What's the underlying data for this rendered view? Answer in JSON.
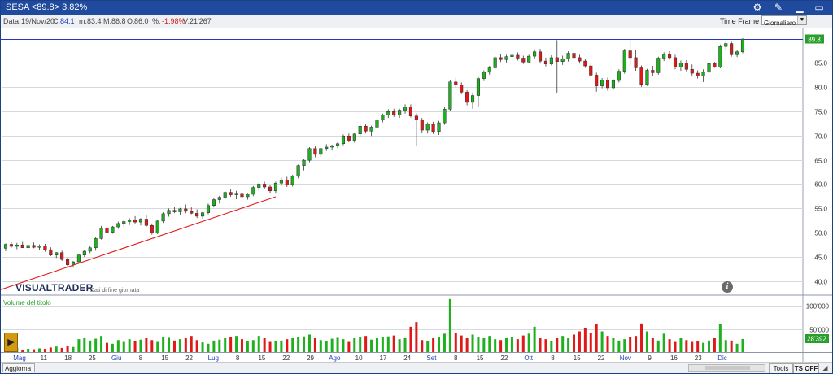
{
  "titlebar": {
    "title": "SESA <89.8> 3.82%"
  },
  "infobar": {
    "date_label": "Data:",
    "date": "19/Nov/20",
    "close_label": "C:",
    "close": "84.1",
    "min_label": "m:",
    "min": "83.4",
    "max_label": "M:",
    "max": "86.8",
    "open_label": "O:",
    "open": "86.0",
    "pct_label": "%:",
    "pct": "-1.98%",
    "vol_label": "V:",
    "vol": "21'267",
    "timeframe_label": "Time Frame",
    "timeframe_value": "Giornaliero"
  },
  "watermark": {
    "brand": "VISUALTRADER",
    "sub": "Dati di fine giornata"
  },
  "volume_title": "Volume del titolo",
  "bottombar": {
    "refresh": "Aggiorna",
    "tools": "Tools",
    "ts_off": "TS OFF"
  },
  "colors": {
    "up": "#1fb01f",
    "down": "#e01818",
    "trendline": "#e41a1a",
    "title_bg": "#1f4a9e",
    "last_price_bg": "#2a9e2a"
  },
  "chart_data": {
    "type": "candlestick",
    "price_axis": {
      "ylim": [
        37.5,
        91
      ],
      "ticks": [
        40.0,
        45.0,
        50.0,
        55.0,
        60.0,
        65.0,
        70.0,
        75.0,
        80.0,
        85.0
      ],
      "last_price": 89.8,
      "last_price_label": "89.8"
    },
    "volume_axis": {
      "ylim": [
        0,
        120000
      ],
      "ticks": [
        50000,
        100000
      ],
      "tick_labels": [
        "50'000",
        "100'000"
      ],
      "last_volume_label": "28'392"
    },
    "x_labels": [
      "Mag",
      "11",
      "18",
      "25",
      "Giu",
      "8",
      "15",
      "22",
      "Lug",
      "8",
      "15",
      "22",
      "29",
      "Ago",
      "10",
      "17",
      "24",
      "Set",
      "8",
      "15",
      "22",
      "Ott",
      "8",
      "15",
      "22",
      "Nov",
      "9",
      "16",
      "23",
      "Dic"
    ],
    "x_label_colors": [
      "blue",
      "dark",
      "dark",
      "dark",
      "blue",
      "dark",
      "dark",
      "dark",
      "blue",
      "dark",
      "dark",
      "dark",
      "dark",
      "blue",
      "dark",
      "dark",
      "dark",
      "blue",
      "dark",
      "dark",
      "dark",
      "blue",
      "dark",
      "dark",
      "dark",
      "blue",
      "dark",
      "dark",
      "dark",
      "blue"
    ],
    "ohlc": [
      [
        46.8,
        47.8,
        46.2,
        47.6
      ],
      [
        47.6,
        48.0,
        46.9,
        47.2
      ],
      [
        47.2,
        47.9,
        46.6,
        47.5
      ],
      [
        47.5,
        48.1,
        47.0,
        46.9
      ],
      [
        46.9,
        47.6,
        46.3,
        47.4
      ],
      [
        47.4,
        48.0,
        46.8,
        47.0
      ],
      [
        47.0,
        47.6,
        46.4,
        47.3
      ],
      [
        47.3,
        47.7,
        46.1,
        46.5
      ],
      [
        46.5,
        47.0,
        45.2,
        45.4
      ],
      [
        45.4,
        46.0,
        44.8,
        45.9
      ],
      [
        45.9,
        46.3,
        44.2,
        44.5
      ],
      [
        44.5,
        44.9,
        43.0,
        43.4
      ],
      [
        43.4,
        44.2,
        42.8,
        44.0
      ],
      [
        44.0,
        45.6,
        43.7,
        45.4
      ],
      [
        45.4,
        46.5,
        45.0,
        46.2
      ],
      [
        46.2,
        47.2,
        45.8,
        46.9
      ],
      [
        46.9,
        49.2,
        46.3,
        48.8
      ],
      [
        48.8,
        51.4,
        48.6,
        51.0
      ],
      [
        51.0,
        51.8,
        49.5,
        50.1
      ],
      [
        50.1,
        51.4,
        49.8,
        51.2
      ],
      [
        51.2,
        52.3,
        50.8,
        51.9
      ],
      [
        51.9,
        52.6,
        51.3,
        52.3
      ],
      [
        52.3,
        53.0,
        51.6,
        52.6
      ],
      [
        52.6,
        53.4,
        51.9,
        52.2
      ],
      [
        52.2,
        53.0,
        51.5,
        52.8
      ],
      [
        52.8,
        53.6,
        51.2,
        51.5
      ],
      [
        51.5,
        51.9,
        49.6,
        50.0
      ],
      [
        50.0,
        52.7,
        49.7,
        52.4
      ],
      [
        52.4,
        54.2,
        52.0,
        53.9
      ],
      [
        53.9,
        55.0,
        53.3,
        54.6
      ],
      [
        54.6,
        55.3,
        54.0,
        54.3
      ],
      [
        54.3,
        55.1,
        53.6,
        54.9
      ],
      [
        54.9,
        55.8,
        54.0,
        54.4
      ],
      [
        54.4,
        55.2,
        53.8,
        54.0
      ],
      [
        54.0,
        54.8,
        53.0,
        53.4
      ],
      [
        53.4,
        54.3,
        52.9,
        54.1
      ],
      [
        54.1,
        56.0,
        53.8,
        55.6
      ],
      [
        55.6,
        57.1,
        55.2,
        56.8
      ],
      [
        56.8,
        57.6,
        56.0,
        57.3
      ],
      [
        57.3,
        58.6,
        56.8,
        58.3
      ],
      [
        58.3,
        59.0,
        57.4,
        57.8
      ],
      [
        57.8,
        58.6,
        56.9,
        58.1
      ],
      [
        58.1,
        58.8,
        57.0,
        57.4
      ],
      [
        57.4,
        58.2,
        56.8,
        57.9
      ],
      [
        57.9,
        59.6,
        57.5,
        59.3
      ],
      [
        59.3,
        60.3,
        58.6,
        60.0
      ],
      [
        60.0,
        60.5,
        59.0,
        59.4
      ],
      [
        59.4,
        59.8,
        58.2,
        58.6
      ],
      [
        58.6,
        60.5,
        58.2,
        60.2
      ],
      [
        60.2,
        61.3,
        59.6,
        60.8
      ],
      [
        60.8,
        61.5,
        59.4,
        59.9
      ],
      [
        59.9,
        61.9,
        59.5,
        61.6
      ],
      [
        61.6,
        64.0,
        61.2,
        63.8
      ],
      [
        63.8,
        65.2,
        62.8,
        64.9
      ],
      [
        64.9,
        67.6,
        64.5,
        67.3
      ],
      [
        67.3,
        67.9,
        65.5,
        66.1
      ],
      [
        66.1,
        67.5,
        65.6,
        67.3
      ],
      [
        67.3,
        68.2,
        66.8,
        67.6
      ],
      [
        67.6,
        68.1,
        66.9,
        67.9
      ],
      [
        67.9,
        68.6,
        67.4,
        68.3
      ],
      [
        68.3,
        70.2,
        68.0,
        69.9
      ],
      [
        69.9,
        70.4,
        68.6,
        69.0
      ],
      [
        69.0,
        70.6,
        68.5,
        70.3
      ],
      [
        70.3,
        72.2,
        69.8,
        71.9
      ],
      [
        71.9,
        72.4,
        70.4,
        70.9
      ],
      [
        70.9,
        72.0,
        69.9,
        71.7
      ],
      [
        71.7,
        73.5,
        71.3,
        73.2
      ],
      [
        73.2,
        74.5,
        72.7,
        74.2
      ],
      [
        74.2,
        75.4,
        73.6,
        74.9
      ],
      [
        74.9,
        75.5,
        73.8,
        74.2
      ],
      [
        74.2,
        75.5,
        73.6,
        75.2
      ],
      [
        75.2,
        76.4,
        74.5,
        75.9
      ],
      [
        75.9,
        76.4,
        73.7,
        74.0
      ],
      [
        74.0,
        74.6,
        67.9,
        73.2
      ],
      [
        73.2,
        73.6,
        70.6,
        71.1
      ],
      [
        71.1,
        72.7,
        70.4,
        72.3
      ],
      [
        72.3,
        72.8,
        70.3,
        70.8
      ],
      [
        70.8,
        73.0,
        70.1,
        72.6
      ],
      [
        72.6,
        75.8,
        72.2,
        75.4
      ],
      [
        75.4,
        81.4,
        75.1,
        81.0
      ],
      [
        81.0,
        81.9,
        79.9,
        80.4
      ],
      [
        80.4,
        80.9,
        78.5,
        78.9
      ],
      [
        78.9,
        79.3,
        76.2,
        76.8
      ],
      [
        76.8,
        78.6,
        75.5,
        78.2
      ],
      [
        78.2,
        82.0,
        75.8,
        81.7
      ],
      [
        81.7,
        83.4,
        81.2,
        83.0
      ],
      [
        83.0,
        84.3,
        82.5,
        83.9
      ],
      [
        83.9,
        86.3,
        83.6,
        86.0
      ],
      [
        86.0,
        86.7,
        85.1,
        85.6
      ],
      [
        85.6,
        86.6,
        85.0,
        86.2
      ],
      [
        86.2,
        86.9,
        85.6,
        86.5
      ],
      [
        86.5,
        87.1,
        85.4,
        85.9
      ],
      [
        85.9,
        86.4,
        84.7,
        85.1
      ],
      [
        85.1,
        86.6,
        84.8,
        86.3
      ],
      [
        86.3,
        87.7,
        85.8,
        87.2
      ],
      [
        87.2,
        87.8,
        84.8,
        85.3
      ],
      [
        85.3,
        86.0,
        84.2,
        84.7
      ],
      [
        84.7,
        86.5,
        84.4,
        86.0
      ],
      [
        86.0,
        89.6,
        78.8,
        85.2
      ],
      [
        85.2,
        86.4,
        84.5,
        85.7
      ],
      [
        85.7,
        87.3,
        85.2,
        86.9
      ],
      [
        86.9,
        87.3,
        85.6,
        86.0
      ],
      [
        86.0,
        86.6,
        84.8,
        85.3
      ],
      [
        85.3,
        85.8,
        83.9,
        84.3
      ],
      [
        84.3,
        84.8,
        81.9,
        82.4
      ],
      [
        82.4,
        82.9,
        79.0,
        80.2
      ],
      [
        80.2,
        81.8,
        79.7,
        81.4
      ],
      [
        81.4,
        81.9,
        79.2,
        79.8
      ],
      [
        79.8,
        81.6,
        79.4,
        81.3
      ],
      [
        81.3,
        83.6,
        80.9,
        83.2
      ],
      [
        83.2,
        87.8,
        82.7,
        87.4
      ],
      [
        87.4,
        89.9,
        84.3,
        86.0
      ],
      [
        86.0,
        87.5,
        83.3,
        83.9
      ],
      [
        83.9,
        84.4,
        80.0,
        80.5
      ],
      [
        80.5,
        83.7,
        80.2,
        83.4
      ],
      [
        83.4,
        84.3,
        82.3,
        82.9
      ],
      [
        82.9,
        86.2,
        82.5,
        85.9
      ],
      [
        85.9,
        87.1,
        85.3,
        86.7
      ],
      [
        86.7,
        87.3,
        85.6,
        86.0
      ],
      [
        86.0,
        86.6,
        83.6,
        84.1
      ],
      [
        84.1,
        85.4,
        83.3,
        84.9
      ],
      [
        84.9,
        85.5,
        83.2,
        83.6
      ],
      [
        83.6,
        84.6,
        82.3,
        82.8
      ],
      [
        82.8,
        83.4,
        81.7,
        82.2
      ],
      [
        82.2,
        83.6,
        81.0,
        83.0
      ],
      [
        83.0,
        85.3,
        82.6,
        84.8
      ],
      [
        84.8,
        85.1,
        83.9,
        84.1
      ],
      [
        84.1,
        88.7,
        83.8,
        88.3
      ],
      [
        88.3,
        89.3,
        87.6,
        88.9
      ],
      [
        88.9,
        89.3,
        86.2,
        86.6
      ],
      [
        86.6,
        87.6,
        86.1,
        87.2
      ],
      [
        87.2,
        90.0,
        86.9,
        89.8
      ]
    ],
    "volumes": [
      8000,
      6000,
      9000,
      5000,
      7000,
      6000,
      8000,
      7000,
      10000,
      12000,
      9000,
      14000,
      11000,
      28000,
      30000,
      25000,
      29000,
      35000,
      20000,
      18000,
      26000,
      22000,
      28000,
      24000,
      27000,
      30000,
      26000,
      22000,
      33000,
      31000,
      25000,
      28000,
      30000,
      35000,
      26000,
      21000,
      18000,
      25000,
      27000,
      30000,
      32000,
      35000,
      28000,
      24000,
      26000,
      35000,
      30000,
      22000,
      23000,
      25000,
      28000,
      30000,
      32000,
      34000,
      38000,
      30000,
      26000,
      24000,
      29000,
      31000,
      28000,
      22000,
      30000,
      33000,
      35000,
      27000,
      30000,
      32000,
      34000,
      36000,
      28000,
      30000,
      55000,
      65000,
      26000,
      24000,
      30000,
      32000,
      40000,
      115000,
      42000,
      36000,
      30000,
      38000,
      33000,
      30000,
      35000,
      28000,
      26000,
      30000,
      32000,
      28000,
      36000,
      40000,
      55000,
      30000,
      28000,
      24000,
      30000,
      35000,
      30000,
      38000,
      45000,
      52000,
      42000,
      60000,
      45000,
      35000,
      30000,
      25000,
      28000,
      32000,
      35000,
      62000,
      45000,
      30000,
      25000,
      40000,
      28000,
      22000,
      30000,
      26000,
      22000,
      24000,
      20000,
      25000,
      30000,
      60000,
      26000,
      25000,
      18000,
      28392
    ]
  }
}
